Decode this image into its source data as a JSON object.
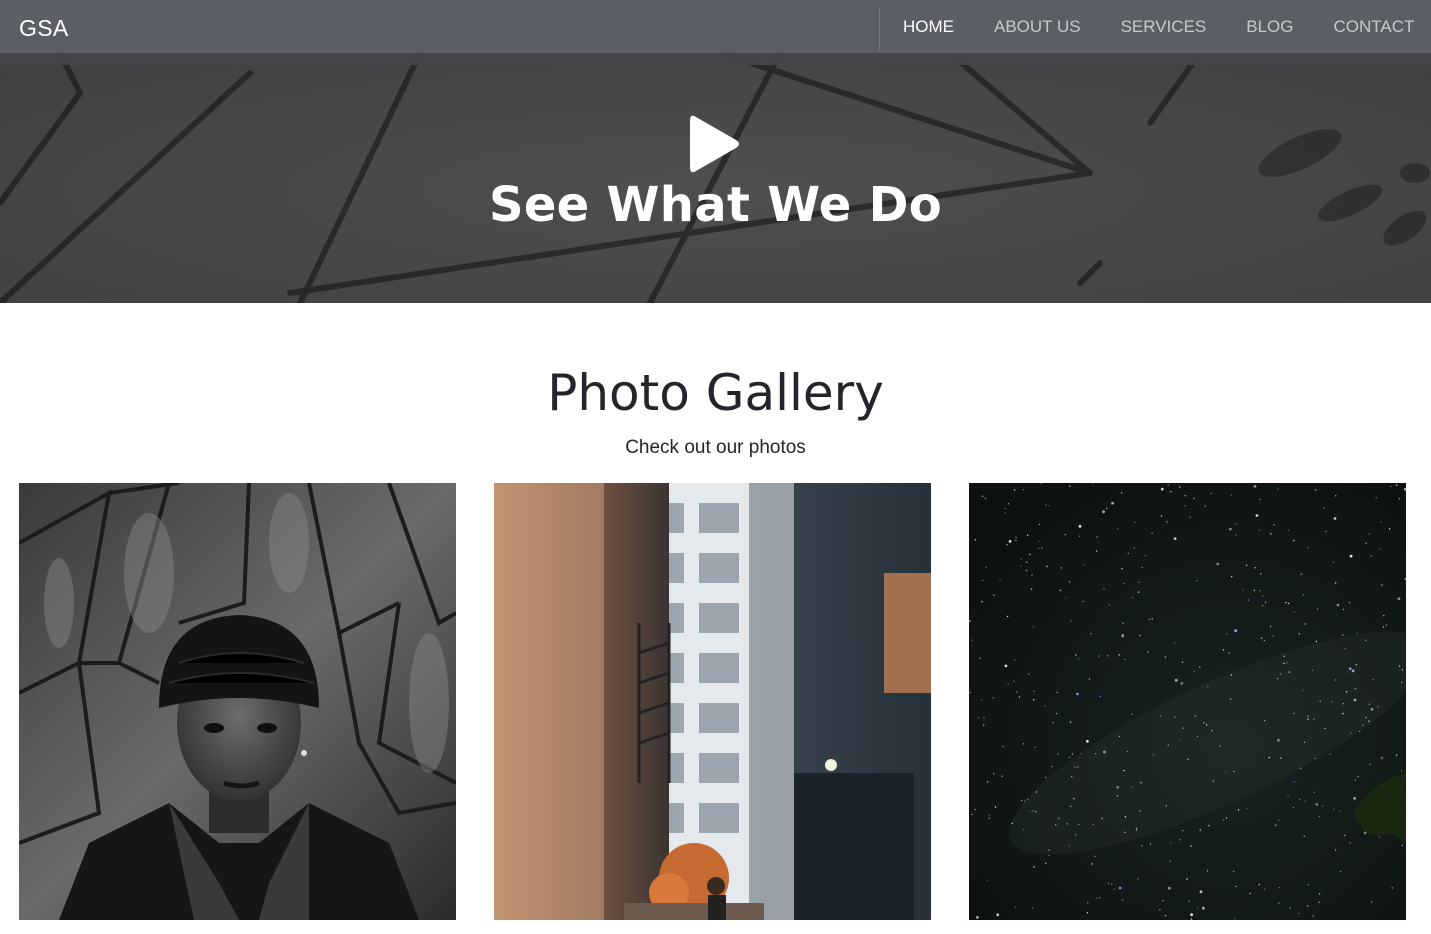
{
  "nav": {
    "brand": "GSA",
    "links": [
      {
        "label": "HOME",
        "active": true
      },
      {
        "label": "ABOUT US",
        "active": false
      },
      {
        "label": "SERVICES",
        "active": false
      },
      {
        "label": "BLOG",
        "active": false
      },
      {
        "label": "CONTACT",
        "active": false
      }
    ]
  },
  "hero": {
    "icon": "play-icon",
    "title": "See What We Do"
  },
  "gallery": {
    "title": "Photo Gallery",
    "subtitle": "Check out our photos",
    "photos": [
      {
        "subject": "portrait-photo"
      },
      {
        "subject": "city-alley-photo"
      },
      {
        "subject": "starry-sky-photo"
      }
    ]
  },
  "colors": {
    "navbar": "#5b5e64",
    "hero": "#4d4d4e",
    "text_dark": "#222529",
    "nav_link": "#c8c9cb"
  }
}
